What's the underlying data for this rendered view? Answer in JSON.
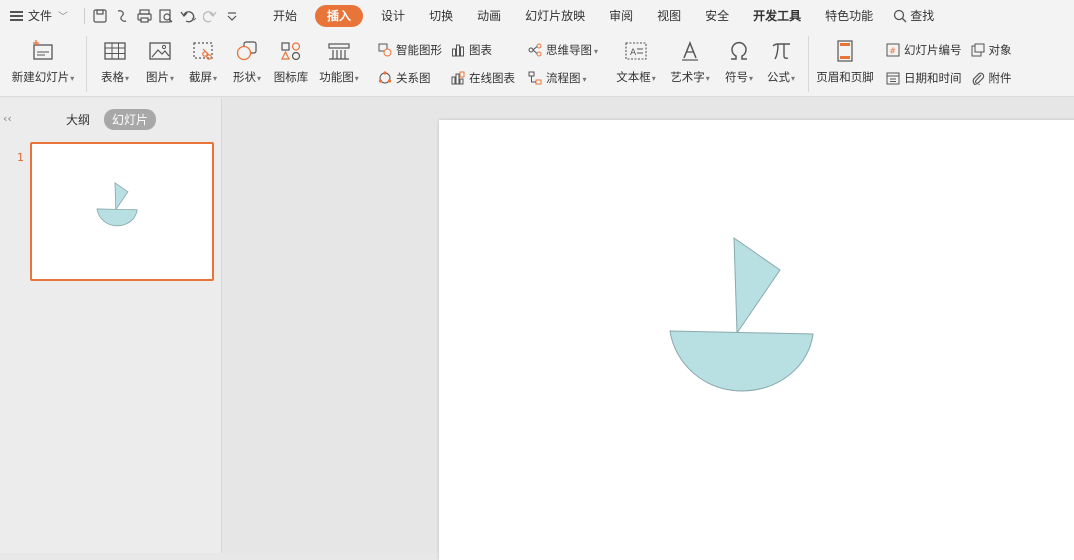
{
  "menu": {
    "file_label": "文件",
    "tabs": [
      {
        "label": "开始"
      },
      {
        "label": "插入"
      },
      {
        "label": "设计"
      },
      {
        "label": "切换"
      },
      {
        "label": "动画"
      },
      {
        "label": "幻灯片放映"
      },
      {
        "label": "审阅"
      },
      {
        "label": "视图"
      },
      {
        "label": "安全"
      },
      {
        "label": "开发工具"
      },
      {
        "label": "特色功能"
      }
    ],
    "search_label": "查找"
  },
  "ribbon": {
    "new_slide": "新建幻灯片",
    "table": "表格",
    "picture": "图片",
    "screenshot": "截屏",
    "shape": "形状",
    "icon_lib": "图标库",
    "func_chart": "功能图",
    "smart_art": "智能图形",
    "relation": "关系图",
    "chart": "图表",
    "online_chart": "在线图表",
    "mindmap": "思维导图",
    "flowchart": "流程图",
    "textbox": "文本框",
    "wordart": "艺术字",
    "symbol": "符号",
    "formula": "公式",
    "header_footer": "页眉和页脚",
    "slide_number": "幻灯片编号",
    "object": "对象",
    "datetime": "日期和时间",
    "attachment": "附件"
  },
  "left_pane": {
    "outline_tab": "大纲",
    "slides_tab": "幻灯片",
    "slide_number": "1"
  },
  "colors": {
    "accent": "#e8743a",
    "shape_fill": "#b8dfe2",
    "shape_stroke": "#8aa9ad"
  }
}
